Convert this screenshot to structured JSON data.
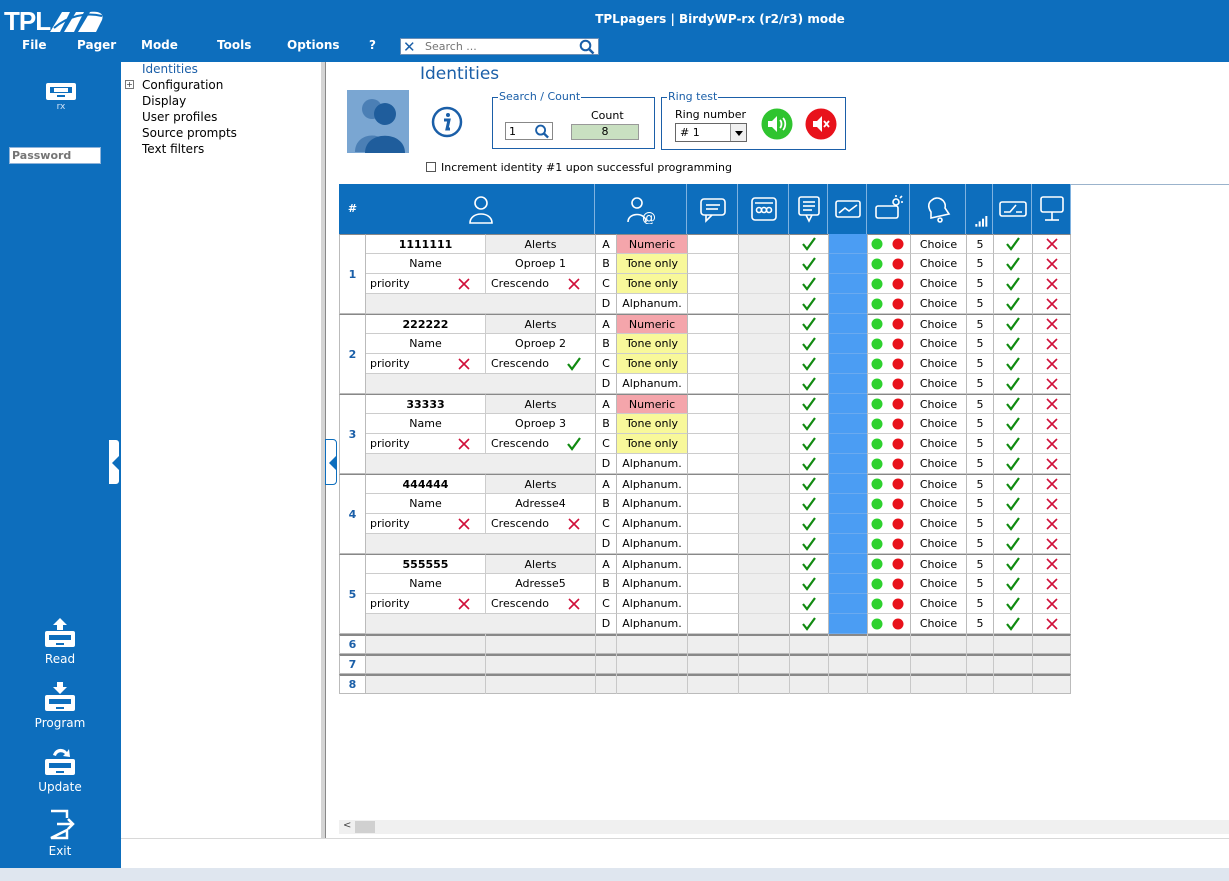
{
  "app": {
    "logo_text": "TPL",
    "title": "TPLpagers | BirdyWP-rx (r2/r3) mode"
  },
  "menu": [
    "File",
    "Pager",
    "Mode",
    "Tools",
    "Options",
    "?"
  ],
  "search": {
    "placeholder": "Search ..."
  },
  "sidebar": {
    "device_label": "rx",
    "password_placeholder": "Password",
    "buttons": {
      "read": "Read",
      "program": "Program",
      "update": "Update",
      "exit": "Exit"
    }
  },
  "nav": {
    "items": [
      "Identities",
      "Configuration",
      "Display",
      "User profiles",
      "Source prompts",
      "Text filters"
    ],
    "selected": 0,
    "expand_glyph": "+"
  },
  "page": {
    "title": "Identities",
    "search_count": {
      "legend": "Search / Count",
      "search_value": "1",
      "count_label": "Count",
      "count_value": "8"
    },
    "ring_test": {
      "legend": "Ring test",
      "ring_number_label": "Ring number",
      "ring_number_value": "# 1"
    },
    "increment_label": "Increment identity #1 upon successful programming",
    "increment_checked": false
  },
  "table": {
    "hash_header": "#",
    "header_icons": [
      "user-icon",
      "email-user-icon",
      "message-icon",
      "pager-group-icon",
      "message-list-icon",
      "display-icon",
      "pager-light-icon",
      "bell-icon",
      "signal-icon",
      "switch-icon",
      "monitor-icon"
    ],
    "sub_labels": [
      "A",
      "B",
      "C",
      "D"
    ],
    "colors": {
      "header": "#0d6ebd",
      "numeric": "#f4a5ab",
      "tone_only": "#f8f89a",
      "blue_cell": "#4b9df3",
      "check": "#118a11",
      "cross": "#d0103a",
      "green_dot": "#2ed12e",
      "red_dot": "#e8121b"
    },
    "identities": [
      {
        "number": "1",
        "code": "1111111",
        "alerts": "Alerts",
        "name_label": "Name",
        "name": "Oproep 1",
        "priority_label": "priority",
        "priority": false,
        "crescendo_label": "Crescendo",
        "crescendo": false,
        "rows": [
          {
            "type": "Numeric",
            "style": "numeric"
          },
          {
            "type": "Tone only",
            "style": "tone"
          },
          {
            "type": "Tone only",
            "style": "tone"
          },
          {
            "type": "Alphanum.",
            "style": "plain"
          }
        ],
        "ring": "Choice",
        "level": "5"
      },
      {
        "number": "2",
        "code": "222222",
        "alerts": "Alerts",
        "name_label": "Name",
        "name": "Oproep 2",
        "priority_label": "priority",
        "priority": false,
        "crescendo_label": "Crescendo",
        "crescendo": true,
        "rows": [
          {
            "type": "Numeric",
            "style": "numeric"
          },
          {
            "type": "Tone only",
            "style": "tone"
          },
          {
            "type": "Tone only",
            "style": "tone"
          },
          {
            "type": "Alphanum.",
            "style": "plain"
          }
        ],
        "ring": "Choice",
        "level": "5"
      },
      {
        "number": "3",
        "code": "33333",
        "alerts": "Alerts",
        "name_label": "Name",
        "name": "Oproep 3",
        "priority_label": "priority",
        "priority": false,
        "crescendo_label": "Crescendo",
        "crescendo": true,
        "rows": [
          {
            "type": "Numeric",
            "style": "numeric"
          },
          {
            "type": "Tone only",
            "style": "tone"
          },
          {
            "type": "Tone only",
            "style": "tone"
          },
          {
            "type": "Alphanum.",
            "style": "plain"
          }
        ],
        "ring": "Choice",
        "level": "5"
      },
      {
        "number": "4",
        "code": "444444",
        "alerts": "Alerts",
        "name_label": "Name",
        "name": "Adresse4",
        "priority_label": "priority",
        "priority": false,
        "crescendo_label": "Crescendo",
        "crescendo": false,
        "rows": [
          {
            "type": "Alphanum.",
            "style": "plain"
          },
          {
            "type": "Alphanum.",
            "style": "plain"
          },
          {
            "type": "Alphanum.",
            "style": "plain"
          },
          {
            "type": "Alphanum.",
            "style": "plain"
          }
        ],
        "ring": "Choice",
        "level": "5"
      },
      {
        "number": "5",
        "code": "555555",
        "alerts": "Alerts",
        "name_label": "Name",
        "name": "Adresse5",
        "priority_label": "priority",
        "priority": false,
        "crescendo_label": "Crescendo",
        "crescendo": false,
        "rows": [
          {
            "type": "Alphanum.",
            "style": "plain"
          },
          {
            "type": "Alphanum.",
            "style": "plain"
          },
          {
            "type": "Alphanum.",
            "style": "plain"
          },
          {
            "type": "Alphanum.",
            "style": "plain"
          }
        ],
        "ring": "Choice",
        "level": "5"
      }
    ],
    "empty_rows": [
      "6",
      "7",
      "8"
    ]
  }
}
